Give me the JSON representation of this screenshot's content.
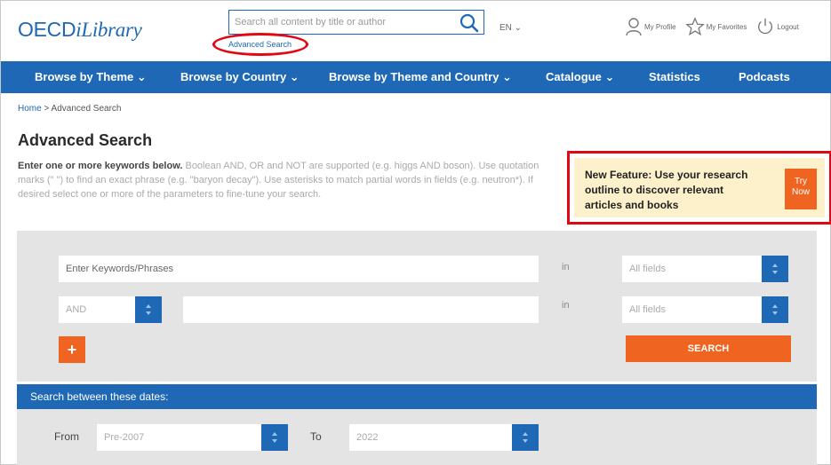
{
  "header": {
    "logo_oecd": "OECD",
    "logo_ilibrary": "iLibrary",
    "search_placeholder": "Search all content by title or author",
    "advanced_search_link": "Advanced Search",
    "language": "EN ⌄",
    "my_profile": "My Profile",
    "my_favorites": "My Favorites",
    "logout": "Logout"
  },
  "nav": {
    "items": [
      {
        "label": "Browse by Theme ⌄"
      },
      {
        "label": "Browse by Country ⌄"
      },
      {
        "label": "Browse by Theme and Country ⌄"
      },
      {
        "label": "Catalogue ⌄"
      },
      {
        "label": "Statistics"
      },
      {
        "label": "Podcasts"
      }
    ]
  },
  "breadcrumb": {
    "home": "Home",
    "separator": " > ",
    "current": "Advanced Search"
  },
  "main": {
    "title": "Advanced Search",
    "intro_bold": "Enter one or more keywords below.",
    "intro_rest": " Boolean AND, OR and NOT are supported (e.g. higgs AND boson). Use quotation marks (\" \") to find an exact phrase (e.g. \"baryon decay\"). Use asterisks to match partial words in fields (e.g. neutron*). If desired select one or more of the parameters to fine-tune your search."
  },
  "feature": {
    "text": "New Feature: Use your research outline to discover relevant articles and books",
    "button_label": "Try Now"
  },
  "search_form": {
    "keywords_placeholder": "Enter Keywords/Phrases",
    "in_label": "in",
    "field_1": "All fields",
    "operator": "AND",
    "field_2": "All fields",
    "add_label": "+",
    "search_label": "SEARCH"
  },
  "dates": {
    "header": "Search between these dates:",
    "from_label": "From",
    "from_value": "Pre-2007",
    "to_label": "To",
    "to_value": "2022"
  },
  "colors": {
    "brand_blue": "#1e68b5",
    "accent_orange": "#f06421",
    "highlight_red": "#e30613",
    "feature_bg": "#fdf1cc"
  }
}
